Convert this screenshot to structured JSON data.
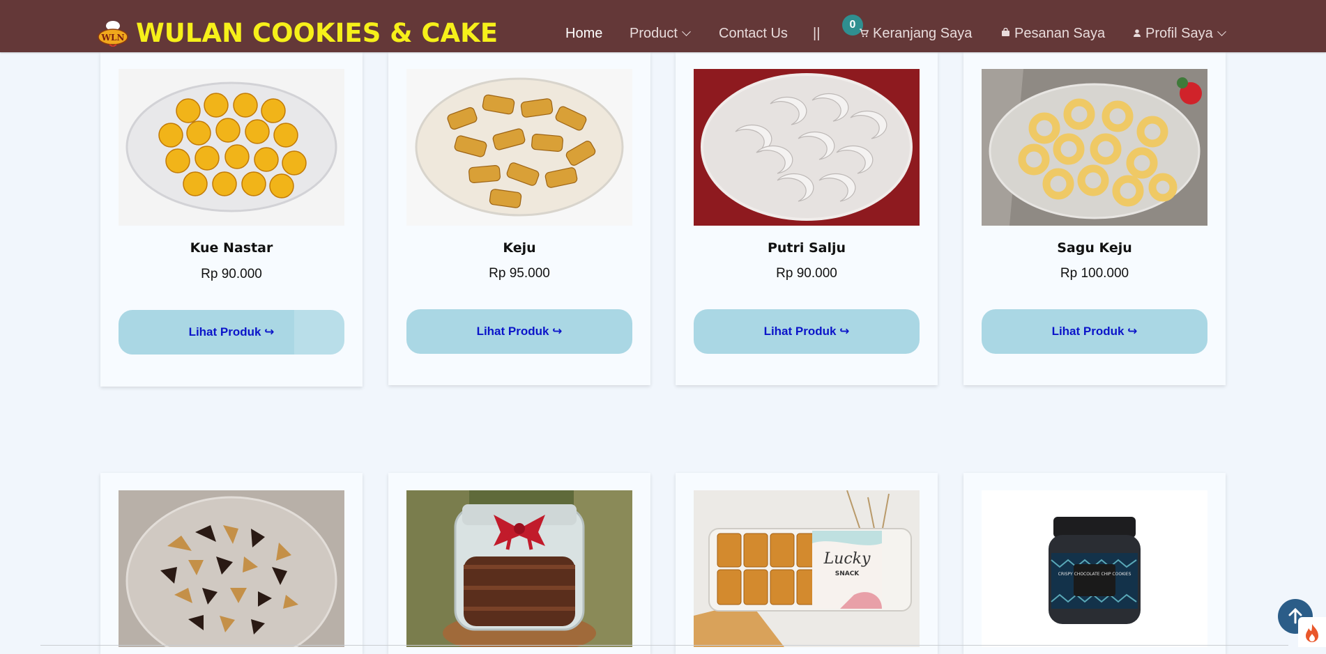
{
  "brand": {
    "name": "WULAN COOKIES & CAKE",
    "logo_text": "WLN"
  },
  "nav": {
    "home": "Home",
    "product": "Product",
    "contact": "Contact Us",
    "separator": "||",
    "cart_count": "0",
    "cart": "Keranjang Saya",
    "orders": "Pesanan Saya",
    "profile": "Profil Saya"
  },
  "products": [
    {
      "name": "Kue Nastar",
      "price": "Rp 90.000",
      "button": "Lihat Produk ↪"
    },
    {
      "name": "Keju",
      "price": "Rp 95.000",
      "button": "Lihat Produk ↪"
    },
    {
      "name": "Putri Salju",
      "price": "Rp 90.000",
      "button": "Lihat Produk ↪"
    },
    {
      "name": "Sagu Keju",
      "price": "Rp 100.000",
      "button": "Lihat Produk ↪"
    }
  ],
  "product_images_row2": {
    "lucky_label": "Lucky",
    "lucky_sub": "SNACK",
    "jar_label": "CRISPY CHOCOLATE CHIP COOKIES"
  },
  "colors": {
    "navbar": "#643838",
    "brand": "#f6f01a",
    "button": "#aad7e4",
    "button_text": "#0b14c9",
    "background": "#f1f6fc"
  }
}
